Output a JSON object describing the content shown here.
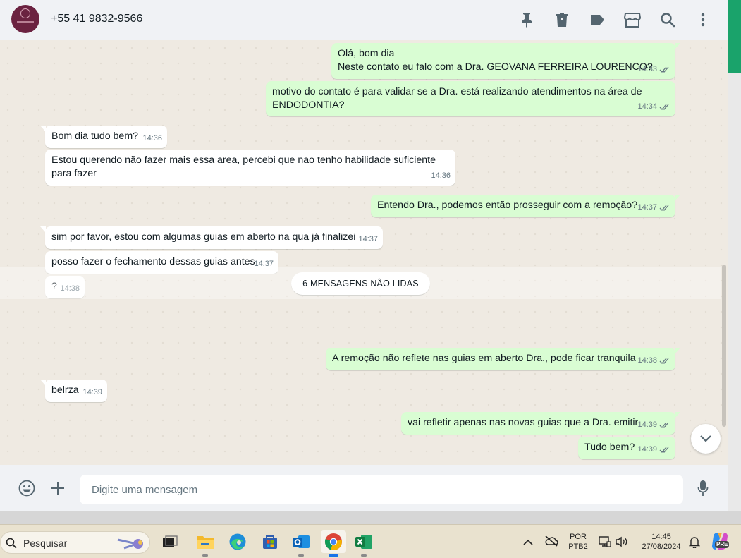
{
  "header": {
    "contact_name": "+55 41 9832-9566",
    "icons": [
      "pin-icon",
      "delete-icon",
      "label-icon",
      "store-icon",
      "search-icon",
      "more-icon"
    ]
  },
  "messages": [
    {
      "dir": "out",
      "text": "Olá, bom dia\nNeste contato eu falo com a Dra. GEOVANA FERREIRA LOURENCO?",
      "time": "14:33"
    },
    {
      "dir": "out",
      "text": "motivo do contato é para validar se a Dra. está realizando atendimentos na área de\nENDODONTIA?",
      "time": "14:34"
    },
    {
      "dir": "in",
      "text": "Bom dia tudo bem?",
      "time": "14:36"
    },
    {
      "dir": "in",
      "text": "Estou querendo não fazer mais essa area, percebi que nao tenho habilidade suficiente\npara fazer",
      "time": "14:36"
    },
    {
      "dir": "out",
      "text": "Entendo Dra., podemos então prosseguir com a remoção?",
      "time": "14:37"
    },
    {
      "dir": "in",
      "text": "sim por favor, estou com algumas guias em aberto na qua já finalizei",
      "time": "14:37"
    },
    {
      "dir": "in",
      "text": "posso fazer o fechamento dessas guias antes",
      "time": "14:37"
    },
    {
      "dir": "in",
      "text": "?",
      "time": "14:38"
    },
    {
      "dir": "out",
      "text": "A remoção não reflete nas guias em aberto Dra., pode ficar tranquila",
      "time": "14:38"
    },
    {
      "dir": "in",
      "text": "belrza",
      "time": "14:39"
    },
    {
      "dir": "out",
      "text": "vai refletir apenas nas novas guias que a Dra. emitir",
      "time": "14:39"
    },
    {
      "dir": "out",
      "text": "Tudo bem?",
      "time": "14:39"
    }
  ],
  "unread_divider": "6 MENSAGENS NÃO LIDAS",
  "compose": {
    "placeholder": "Digite uma mensagem"
  },
  "taskbar": {
    "search_label": "Pesquisar",
    "language_top": "POR",
    "language_bottom": "PTB2",
    "time": "14:45",
    "date": "27/08/2024",
    "copilot_badge": "PRE"
  },
  "colors": {
    "outgoing_bubble": "#d9fdd3",
    "incoming_bubble": "#ffffff",
    "read_tick": "#667781",
    "accent": "#1aa36b"
  }
}
